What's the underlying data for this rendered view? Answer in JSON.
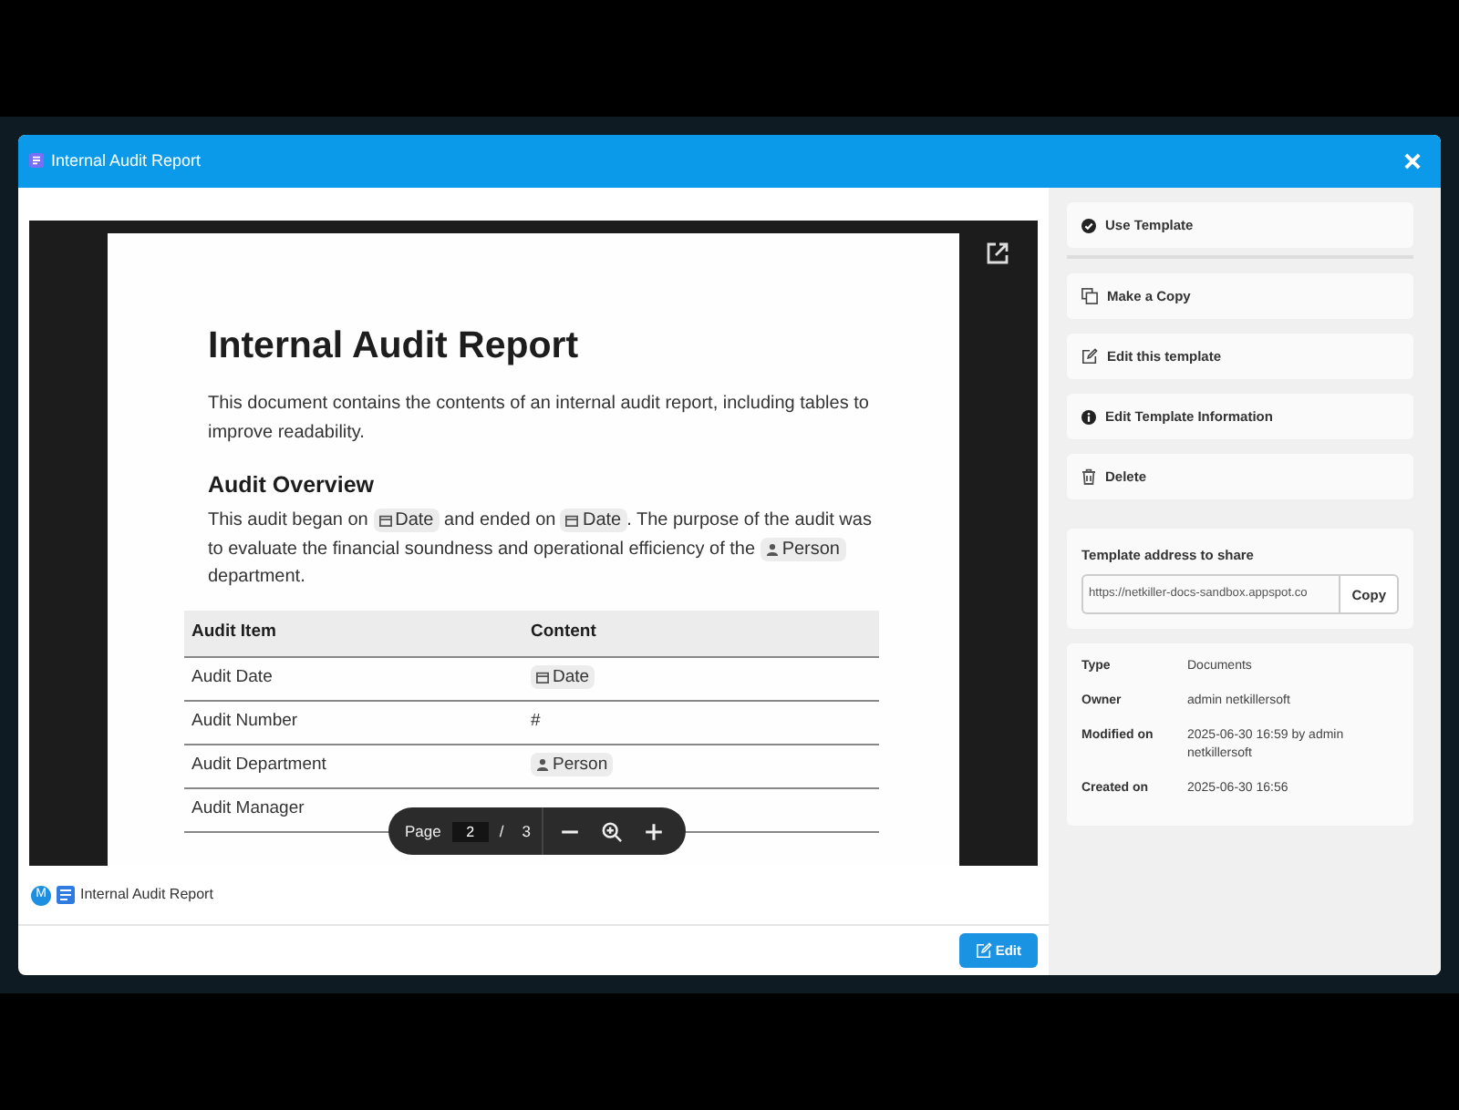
{
  "modal": {
    "title": "Internal Audit Report"
  },
  "document": {
    "title": "Internal Audit Report",
    "intro": "This document contains the contents of an internal audit report, including tables to improve readability.",
    "section_heading": "Audit Overview",
    "paragraph": [
      {
        "kind": "text",
        "text": "This audit began on"
      },
      {
        "kind": "date-chip",
        "text": "Date"
      },
      {
        "kind": "text",
        "text": "and ended on"
      },
      {
        "kind": "date-chip",
        "text": "Date"
      },
      {
        "kind": "text",
        "text": ". The purpose of the audit was"
      },
      {
        "kind": "text",
        "text": "to evaluate the financial soundness and operational efficiency of the"
      },
      {
        "kind": "person-chip",
        "text": "Person"
      },
      {
        "kind": "text",
        "text": "department."
      }
    ],
    "table": {
      "columns": [
        "Audit Item",
        "Content"
      ],
      "rows": [
        {
          "label": "Audit Date",
          "content": {
            "kind": "date-chip",
            "text": "Date"
          }
        },
        {
          "label": "Audit Number",
          "content": {
            "kind": "text",
            "text": "#"
          }
        },
        {
          "label": "Audit Department",
          "content": {
            "kind": "person-chip",
            "text": "Person"
          }
        },
        {
          "label": "Audit Manager"
        }
      ]
    }
  },
  "viewer_toolbar": {
    "page_label": "Page",
    "page": "2",
    "separator": "/",
    "total": "3"
  },
  "breadcrumb": {
    "avatar": "M",
    "title": "Internal Audit Report"
  },
  "footer": {
    "edit_button": "Edit"
  },
  "actions": [
    {
      "kind": "use",
      "label": "Use Template",
      "divider_after": true
    },
    {
      "kind": "copy",
      "label": "Make a Copy",
      "divider_after": false
    },
    {
      "kind": "edit",
      "label": "Edit this template",
      "divider_after": false
    },
    {
      "kind": "info",
      "label": "Edit Template Information",
      "divider_after": false
    },
    {
      "kind": "delete",
      "label": "Delete",
      "divider_after": false
    }
  ],
  "share": {
    "label": "Template address to share",
    "value": "https://netkiller-docs-sandbox.appspot.co",
    "button": "Copy"
  },
  "info": [
    {
      "label": "Type",
      "value": "Documents"
    },
    {
      "label": "Owner",
      "value": "admin netkillersoft"
    },
    {
      "label": "Modified on",
      "value": "2025-06-30 16:59 by admin netkillersoft"
    },
    {
      "label": "Created on",
      "value": "2025-06-30 16:56"
    }
  ]
}
